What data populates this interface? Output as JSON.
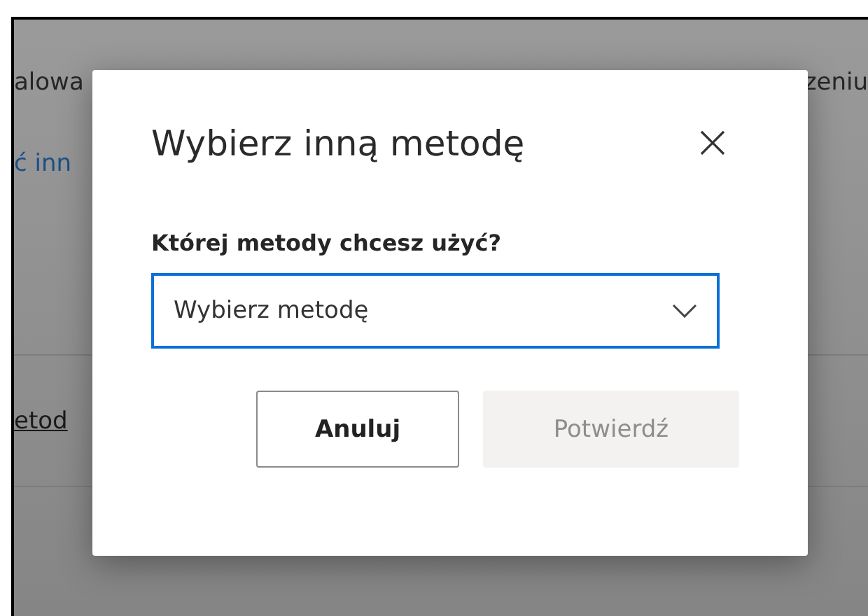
{
  "background": {
    "top_line": {
      "left": "alowa",
      "right": "zeniu"
    },
    "link": "ć inn",
    "method_link": "etod"
  },
  "dialog": {
    "title": "Wybierz inną metodę",
    "question": "Której metody chcesz użyć?",
    "select": {
      "value": "Wybierz metodę",
      "focused": true
    },
    "buttons": [
      {
        "label": "Anuluj",
        "kind": "secondary",
        "disabled": false
      },
      {
        "label": "Potwierdź",
        "kind": "primary",
        "disabled": true
      }
    ]
  }
}
